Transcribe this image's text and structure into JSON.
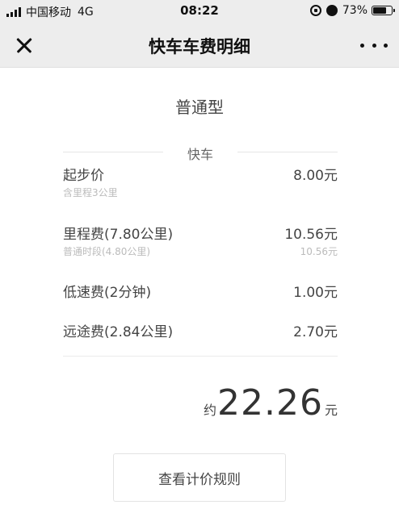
{
  "status_bar": {
    "carrier": "中国移动",
    "network": "4G",
    "time": "08:22",
    "battery_percent": "73%",
    "battery_level": 0.73
  },
  "nav": {
    "title": "快车车费明细"
  },
  "car_type": "普通型",
  "section_label": "快车",
  "fees": [
    {
      "name": "起步价",
      "amount": "8.00元",
      "note": "含里程3公里",
      "note_amount": ""
    },
    {
      "name": "里程费(7.80公里)",
      "amount": "10.56元",
      "note": "普通时段(4.80公里)",
      "note_amount": "10.56元"
    },
    {
      "name": "低速费(2分钟)",
      "amount": "1.00元",
      "note": "",
      "note_amount": ""
    },
    {
      "name": "远途费(2.84公里)",
      "amount": "2.70元",
      "note": "",
      "note_amount": ""
    }
  ],
  "total": {
    "prefix": "约",
    "value": "22.26",
    "unit": "元"
  },
  "rules_button_label": "查看计价规则"
}
